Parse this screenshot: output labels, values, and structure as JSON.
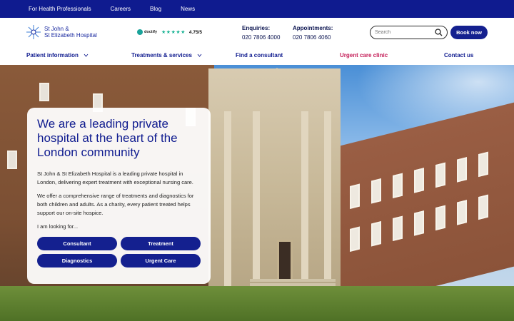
{
  "topbar": {
    "links": [
      "For Health Professionals",
      "Careers",
      "Blog",
      "News"
    ]
  },
  "header": {
    "logo_line1": "St John &",
    "logo_line2": "St Elizabeth Hospital",
    "doctify_brand": "doctify",
    "rating": "4.75/5",
    "enquiries_label": "Enquiries:",
    "enquiries_phone": "020 7806 4000",
    "appointments_label": "Appointments:",
    "appointments_phone": "020 7806 4060",
    "search_placeholder": "Search",
    "book_now": "Book now"
  },
  "nav": {
    "patient_info": "Patient information",
    "treatments": "Treatments & services",
    "find_consultant": "Find a consultant",
    "urgent_care": "Urgent care clinic",
    "contact": "Contact us"
  },
  "hero": {
    "heading": "We are a leading private hospital at the heart of the London community",
    "para1": "St John & St Elizabeth Hospital is a leading private hospital in London, delivering expert treatment with exceptional nursing care.",
    "para2": "We offer a comprehensive range of treatments and diagnostics for both children and adults. As a charity, every patient treated helps support our on-site hospice.",
    "looking_for": "I am looking for...",
    "buttons": [
      "Consultant",
      "Treatment",
      "Diagnostics",
      "Urgent Care"
    ]
  },
  "colors": {
    "brand_navy": "#0f1b8f",
    "urgent_accent": "#c41e58",
    "doctify_green": "#19b394"
  }
}
